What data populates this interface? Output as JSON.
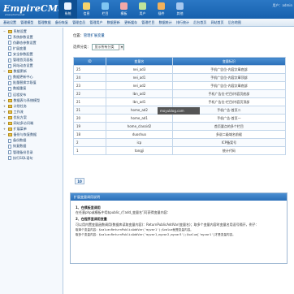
{
  "header": {
    "logo": "EmpireCMS",
    "logo_sub": "www.phome.net",
    "user": "用户：admin",
    "nav": [
      {
        "label": "系统",
        "color": "#e8f2ff",
        "active": true
      },
      {
        "label": "信息",
        "color": "#f6d36b"
      },
      {
        "label": "栏目",
        "color": "#7fc6f2"
      },
      {
        "label": "模板",
        "color": "#f3a8a8"
      },
      {
        "label": "用户",
        "color": "#bfe39a"
      },
      {
        "label": "插件",
        "color": "#f0b15b"
      },
      {
        "label": "其他",
        "color": "#a6c8ef"
      }
    ]
  },
  "subnav": [
    "基础设置",
    "管理模型",
    "管理数据",
    "备份恢复",
    "管理会员",
    "管理用户",
    "数据更新",
    "更新缓存",
    "管理栏目",
    "数据统计",
    "排行统计",
    "后台首页",
    "网站首页",
    "后台地图"
  ],
  "sidebar": [
    {
      "label": "系统设置",
      "type": "folder",
      "toggle": "−",
      "indent": 0
    },
    {
      "label": "系统参数设置",
      "type": "page",
      "indent": 1
    },
    {
      "label": "伪静态参数设置",
      "type": "page",
      "indent": 1
    },
    {
      "label": "扩展变量",
      "type": "page",
      "indent": 1
    },
    {
      "label": "安全参数配置",
      "type": "page",
      "indent": 1
    },
    {
      "label": "管理首页面板",
      "type": "page",
      "indent": 1
    },
    {
      "label": "网站动态设置",
      "type": "page",
      "indent": 1
    },
    {
      "label": "数据更新",
      "type": "folder",
      "toggle": "−",
      "indent": 0
    },
    {
      "label": "数据更新中心",
      "type": "page",
      "indent": 1
    },
    {
      "label": "批量替换字段值",
      "type": "page",
      "indent": 1
    },
    {
      "label": "数据重复",
      "type": "page",
      "indent": 1
    },
    {
      "label": "远程发布",
      "type": "page",
      "indent": 1
    },
    {
      "label": "数据表与系统模型",
      "type": "folder",
      "toggle": "+",
      "indent": 0
    },
    {
      "label": "计划任务",
      "type": "folder",
      "toggle": "+",
      "indent": 0
    },
    {
      "label": "工作流",
      "type": "folder",
      "toggle": "+",
      "indent": 0
    },
    {
      "label": "优化方案",
      "type": "folder",
      "toggle": "+",
      "indent": 0
    },
    {
      "label": "网站多访问端",
      "type": "folder",
      "toggle": "+",
      "indent": 0
    },
    {
      "label": "扩展菜单",
      "type": "folder",
      "toggle": "+",
      "indent": 0
    },
    {
      "label": "备份与恢复数据",
      "type": "folder",
      "toggle": "−",
      "indent": 0
    },
    {
      "label": "备份数据",
      "type": "page",
      "indent": 1
    },
    {
      "label": "恢复数据",
      "type": "page",
      "indent": 1
    },
    {
      "label": "管理备份目录",
      "type": "page",
      "indent": 1
    },
    {
      "label": "执行SQL语句",
      "type": "page",
      "indent": 1
    }
  ],
  "main": {
    "crumb_prefix": "位置：",
    "crumb_link": "管理扩展变量",
    "filter_label": "选择分类：",
    "filter_value": "显示所有分类",
    "columns": [
      "ID",
      "变量名",
      "变量标识"
    ],
    "rows": [
      [
        "25",
        "nei_ad3",
        "手机广告位-内容文章底部"
      ],
      [
        "24",
        "nei_ad1",
        "手机广告位-内容文章顶部"
      ],
      [
        "23",
        "nei_ad2",
        "手机广告位-内容文章底部"
      ],
      [
        "22",
        "lbn_ad2",
        "手机广告位-栏目/内容页底部"
      ],
      [
        "21",
        "lbn_ad1",
        "手机广告位-栏目/内容页顶部"
      ],
      [
        "21",
        "home_ad2",
        "手机广告-首页二"
      ],
      [
        "20",
        "home_ad1",
        "手机广告-首页一"
      ],
      [
        "19",
        "home_classid2",
        "首页要点的多个栏目"
      ],
      [
        "18",
        "duoshuo",
        "多说二级域名前缀"
      ],
      [
        "2",
        "icp",
        "ICP备案号"
      ],
      [
        "1",
        "tongji",
        "统计代码"
      ]
    ],
    "watermark": "moyublog.com",
    "page": "10"
  },
  "help": {
    "title": "扩展变量调用说明",
    "h1": "1、在模板里调用",
    "p1": "在任意php或模板中用$public_r['add_变量名']可获得变量内容：",
    "h2": "2、在程序里调用变量",
    "p2": "可以用内置变量函数调用(数据库读取变量内容)：ReturnPublicAddVar(变量名)；取多个变量内容时变量名用逗号隔开，例子：",
    "p3": "取单个变量内容：$value=ReturnPublicAddVar('myvar1');$value就是变量内容。",
    "p4": "取多个变量内容：$value=ReturnPublicAddVar('myvar1,myvar2,myvar3');$value['myvar1']才是变量内容。"
  }
}
